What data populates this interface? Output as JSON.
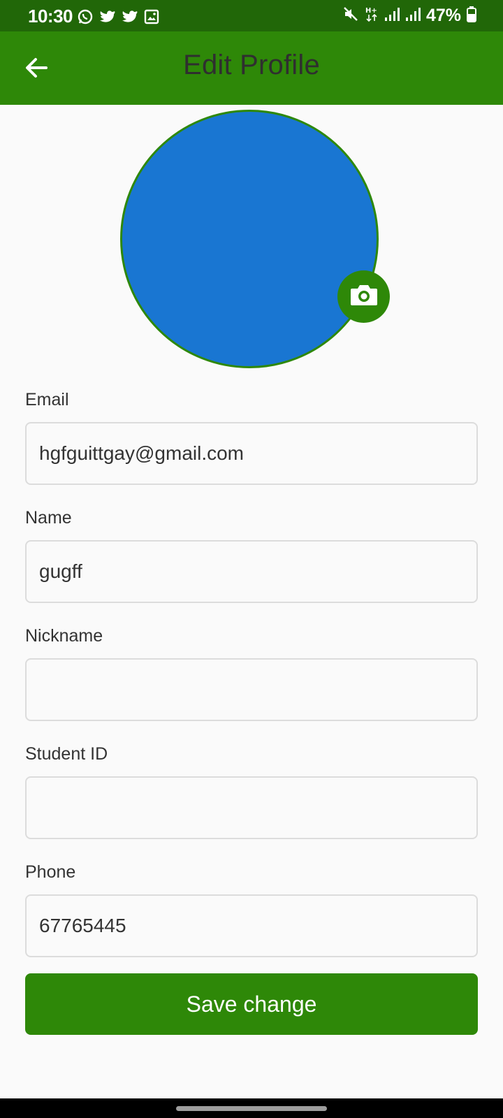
{
  "status_bar": {
    "time": "10:30",
    "battery": "47%",
    "left_icons": [
      "whatsapp-icon",
      "twitter-icon",
      "twitter-icon",
      "gallery-icon"
    ],
    "right_icons": [
      "mute-icon",
      "hplus-data-icon",
      "signal-icon",
      "signal-icon",
      "battery-icon"
    ]
  },
  "app_bar": {
    "title": "Edit Profile",
    "back_icon": "arrow-left-icon"
  },
  "avatar": {
    "color": "#1976d2",
    "camera_icon": "camera-icon"
  },
  "form": {
    "email": {
      "label": "Email",
      "value": "hgfguittgay@gmail.com"
    },
    "name": {
      "label": "Name",
      "value": "gugff"
    },
    "nickname": {
      "label": "Nickname",
      "value": ""
    },
    "student_id": {
      "label": "Student ID",
      "value": ""
    },
    "phone": {
      "label": "Phone",
      "value": "67765445"
    }
  },
  "save_button": {
    "label": "Save change"
  },
  "colors": {
    "status_bar": "#216708",
    "primary": "#2e8808",
    "background": "#fafafa"
  }
}
